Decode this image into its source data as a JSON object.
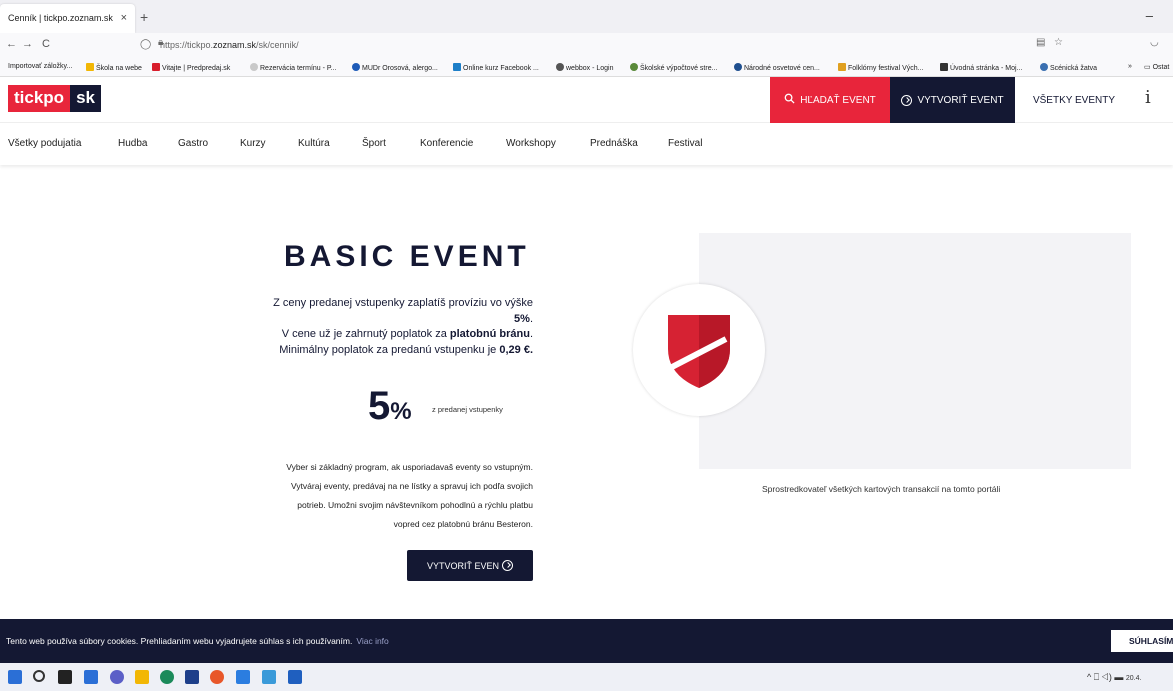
{
  "browser": {
    "tab_title": "Cenník | tickpo.zoznam.sk",
    "tab_close": "×",
    "new_tab": "+",
    "minimize": "–",
    "back": "←",
    "forward": "→",
    "reload": "C",
    "url_prefix": "https://tickpo.",
    "url_host": "zoznam.sk",
    "url_path": "/sk/cennik/",
    "bookmarks": [
      {
        "label": "Importovať záložky...",
        "color": ""
      },
      {
        "label": "Škola na webe",
        "color": "#f2b705"
      },
      {
        "label": "Vitajte | Predpredaj.sk",
        "color": "#d81e2c"
      },
      {
        "label": "Rezervácia termínu - P...",
        "color": "#c9c9c9"
      },
      {
        "label": "MUDr Orosová, alergo...",
        "color": "#1e5bb8"
      },
      {
        "label": "Online kurz Facebook ...",
        "color": "#1e7fc8"
      },
      {
        "label": "webbox - Login",
        "color": "#555555"
      },
      {
        "label": "Školské výpočtové stre...",
        "color": "#5a8a3a"
      },
      {
        "label": "Národné osvetové cen...",
        "color": "#1f4f8f"
      },
      {
        "label": "Folklórny festival Vých...",
        "color": "#e0a020"
      },
      {
        "label": "Úvodná stránka - Moj...",
        "color": "#333333"
      },
      {
        "label": "Scénická žatva",
        "color": "#3a6fb0"
      }
    ],
    "bookmarks_more": "»",
    "bookmarks_other": "Ostat"
  },
  "header": {
    "logo_left": "tickpo",
    "logo_right": "sk",
    "search_label": "HĽADAŤ EVENT",
    "create_label": "VYTVORIŤ EVENT",
    "all_label": "VŠETKY EVENTY",
    "info": "i"
  },
  "categories": [
    "Všetky podujatia",
    "Hudba",
    "Gastro",
    "Kurzy",
    "Kultúra",
    "Šport",
    "Konferencie",
    "Workshopy",
    "Prednáška",
    "Festival"
  ],
  "main": {
    "title": "BASIC EVENT",
    "desc_1": "Z ceny predanej vstupenky zaplatíš províziu vo výške",
    "desc_1_value": "5%",
    "desc_1_end": ".",
    "desc_2": "V cene už je zahrnutý poplatok za",
    "desc_2_bold": "platobnú bránu",
    "desc_2_end": ".",
    "desc_3": "Minimálny poplatok za predanú vstupenku je",
    "desc_3_bold": "0,29 €.",
    "big_value": "5",
    "big_unit": "%",
    "big_note": "z predanej vstupenky",
    "info_1": "Vyber si základný program, ak usporiadavaš eventy so vstupným.",
    "info_2": "Vytváraj eventy, predávaj na ne lístky a spravuj ich podľa svojich",
    "info_3": "potrieb. Umožni svojim návštevníkom pohodlnú a rýchlu platbu",
    "info_4": "vopred cez platobnú bránu Besteron.",
    "button_label": "VYTVORIŤ EVEN",
    "provider_caption": "Sprostredkovateľ všetkých kartových transakcií na tomto portáli"
  },
  "cookie": {
    "text": "Tento web používa súbory cookies. Prehliadaním webu vyjadrujete súhlas s ich používaním.",
    "link": "Viac info",
    "button": "SÚHLASÍM"
  },
  "taskbar": {
    "tray": "^ ⎕ ◁) ▬",
    "clock": "20.4."
  },
  "colors": {
    "brand_red": "#e8253b",
    "brand_navy": "#141833"
  }
}
